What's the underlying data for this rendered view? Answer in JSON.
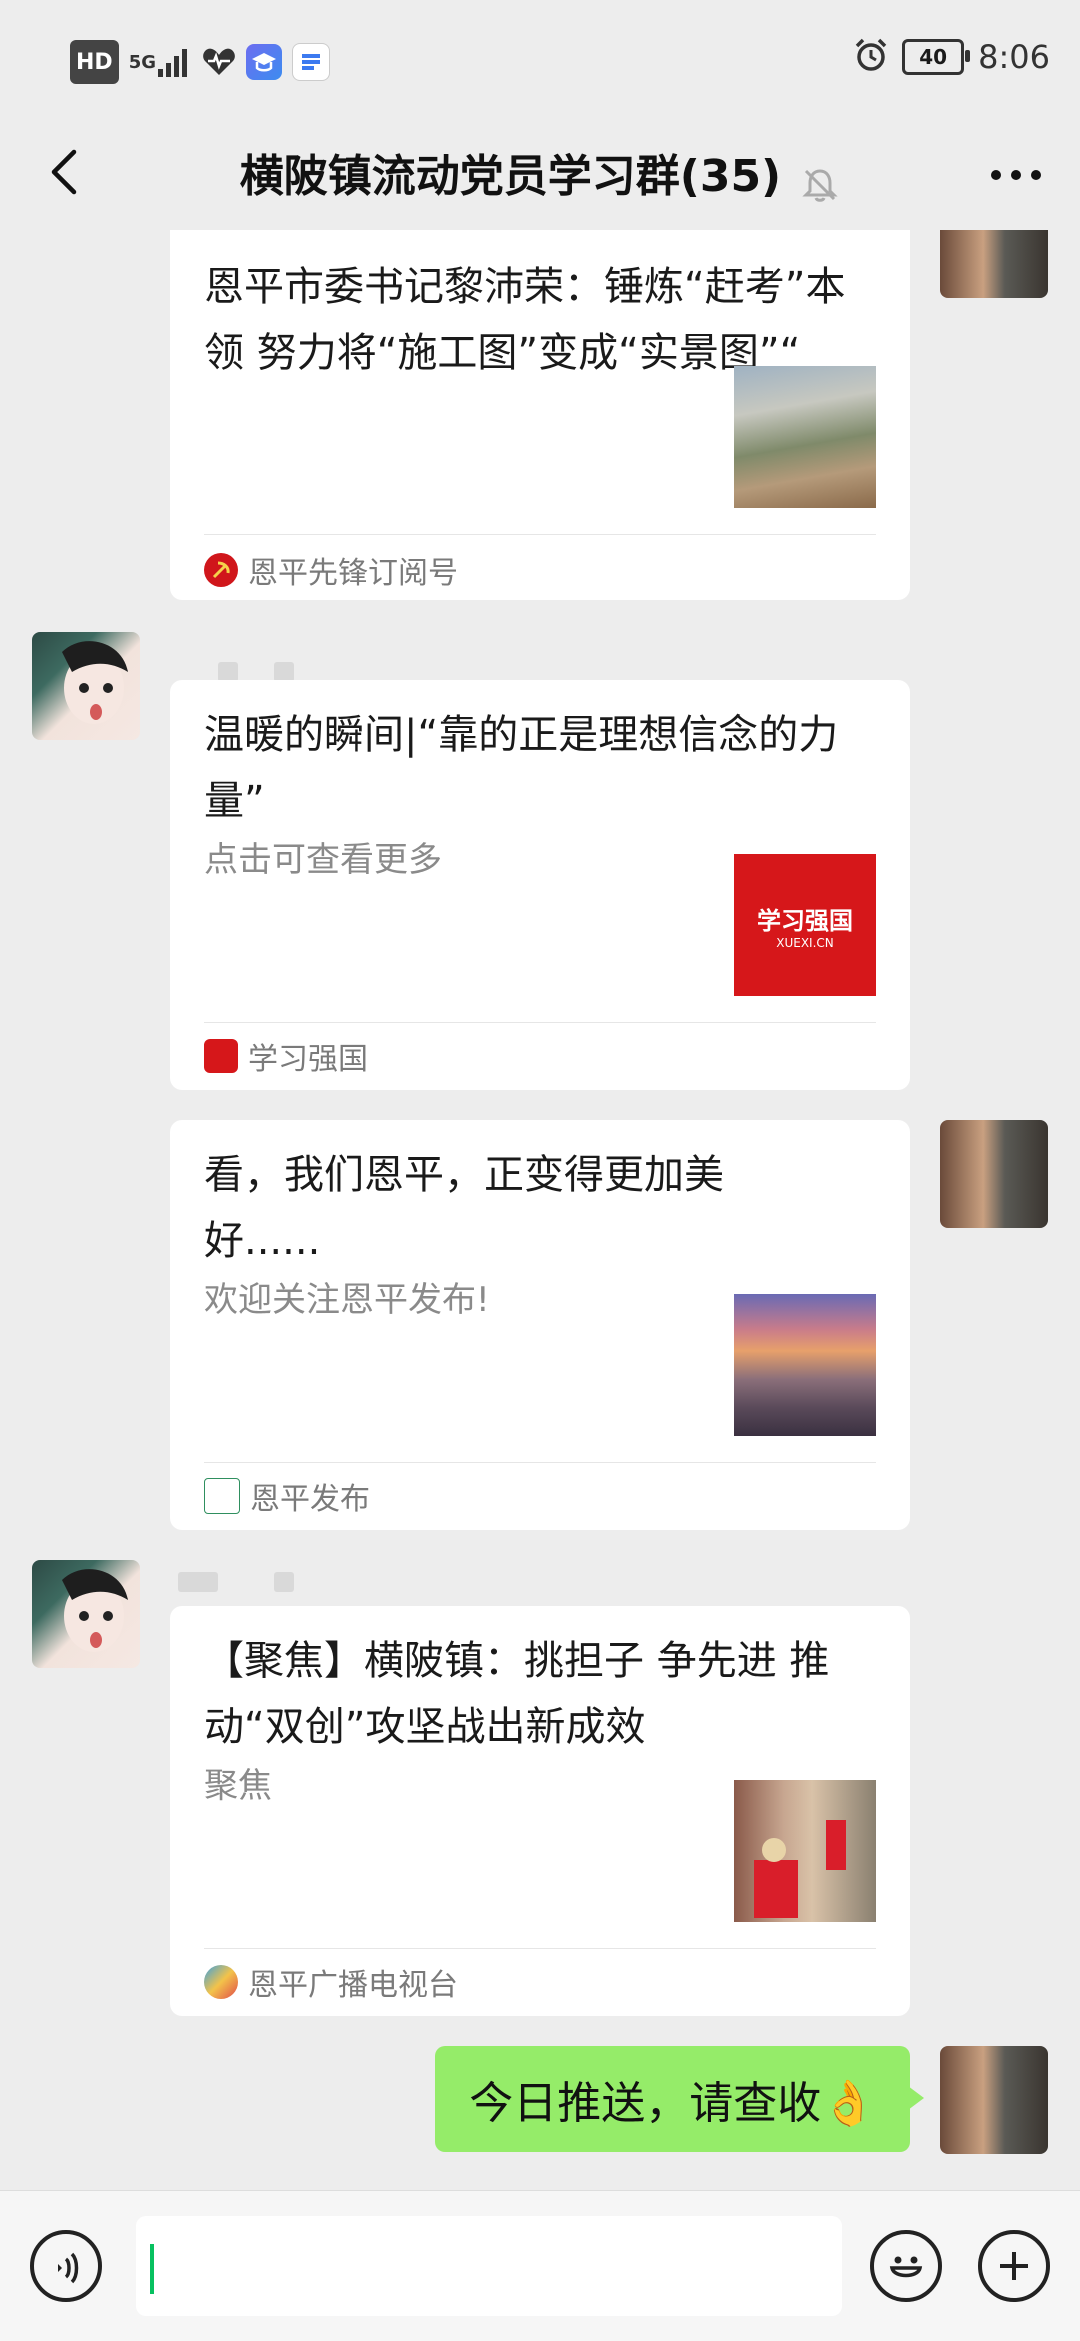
{
  "status": {
    "hd": "HD",
    "network": "5G",
    "battery": "40",
    "time": "8:06"
  },
  "header": {
    "title": "横陂镇流动党员学习群(35)"
  },
  "messages": [
    {
      "title": "恩平市委书记黎沛荣：锤炼“赶考”本领 努力将“施工图”变成“实景图”“",
      "description": "",
      "source": "恩平先锋订阅号"
    },
    {
      "title": "温暖的瞬间|“靠的正是理想信念的力量”",
      "description": "点击可查看更多",
      "source": "学习强国"
    },
    {
      "title": "看，我们恩平，正变得更加美好......",
      "description": "欢迎关注恩平发布!",
      "source": "恩平发布"
    },
    {
      "title": "【聚焦】横陂镇：挑担子 争先进 推动“双创”攻坚战出新成效",
      "description": "聚焦",
      "source": "恩平广播电视台"
    }
  ],
  "outgoing": {
    "text": "今日推送，请查收👌"
  },
  "thumb_text": {
    "xuexi": "学习强国",
    "xuexi_sub": "XUEXI.CN"
  },
  "colors": {
    "bubble_green": "#95ec69",
    "background": "#ededed",
    "caret": "#07c160"
  }
}
